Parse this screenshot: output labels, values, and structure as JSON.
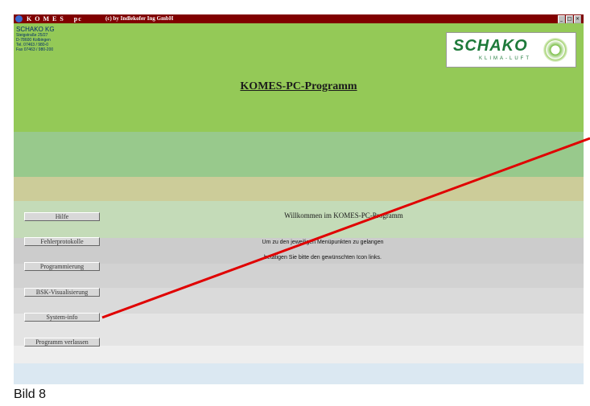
{
  "window": {
    "title": "K O M E S    pc",
    "credit": "(c) by Indlekofer Ing GmbH",
    "controls": [
      "_",
      "□",
      "×"
    ]
  },
  "company": {
    "name": "SCHAKO KG",
    "street": "Steigstraße 25/27",
    "city": "D-78600 Kolbingen",
    "phone": "Tel. 07463 / 980-0",
    "fax": "Fax 07463 / 980-200"
  },
  "logo": {
    "word": "SCHAKO",
    "sub": "KLIMA-LUFT"
  },
  "program_title": "KOMES-PC-Programm",
  "menu": [
    {
      "label": "Hilfe"
    },
    {
      "label": "Fehlerprotokolle"
    },
    {
      "label": "Programmierung"
    },
    {
      "label": "BSK-Visualisierung"
    },
    {
      "label": "System-info"
    },
    {
      "label": "Programm verlassen"
    }
  ],
  "welcome": "Willkommen im KOMES-PC-Programm",
  "info": [
    "Um zu den jeweiligen Menüpunkten zu gelangen",
    "betätigen Sie bitte den gewünschten Icon links."
  ],
  "caption": "Bild 8",
  "colors": {
    "titlebar": "#800000",
    "header_green": "#94c957",
    "pointer_line": "#e00000"
  }
}
